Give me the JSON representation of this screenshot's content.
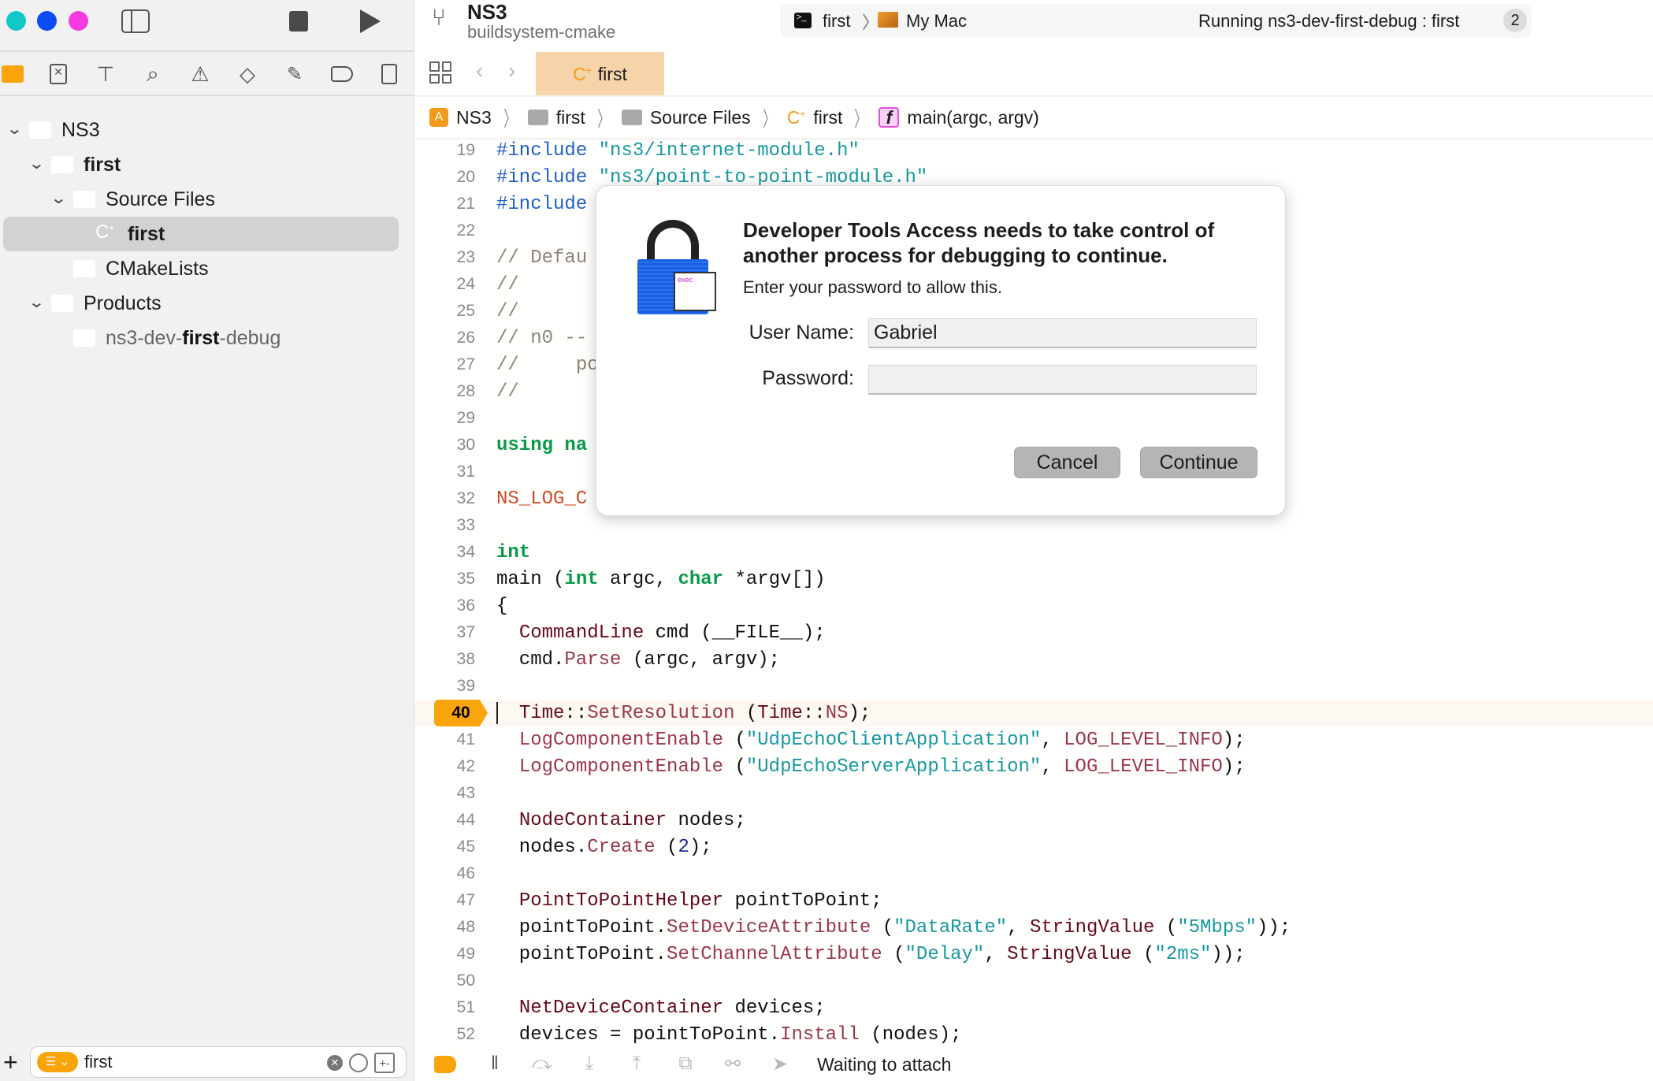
{
  "window": {
    "traffic_lights": [
      "#12c7c9",
      "#0a4cf5",
      "#f53ae2"
    ]
  },
  "toolbar": {
    "project": "NS3",
    "branch": "buildsystem-cmake",
    "scheme": "first",
    "destination": "My Mac",
    "status": "Running ns3-dev-first-debug : first",
    "badge": "2"
  },
  "navigator": {
    "icons": [
      "folder-icon",
      "source-control-icon",
      "hierarchy-icon",
      "search-icon",
      "warning-icon",
      "test-icon",
      "debug-icon",
      "breakpoint-icon",
      "report-icon"
    ],
    "tree": [
      {
        "label": "NS3",
        "icon": "app-icon",
        "level": 0,
        "chevron": true
      },
      {
        "label": "first",
        "icon": "folder-icon",
        "level": 1,
        "chevron": true,
        "bold": true
      },
      {
        "label": "Source Files",
        "icon": "folder-icon",
        "level": 2,
        "chevron": true
      },
      {
        "label": "first",
        "icon": "cpp-file-icon",
        "level": 3,
        "selected": true,
        "bold": true
      },
      {
        "label": "CMakeLists",
        "icon": "text-file-icon",
        "level": 2
      },
      {
        "label": "Products",
        "icon": "folder-icon",
        "level": 1,
        "chevron": true
      },
      {
        "label_pre": "ns3-dev-",
        "label_bold": "first",
        "label_post": "-debug",
        "icon": "executable-icon",
        "level": 2
      }
    ],
    "filter": {
      "value": "first"
    }
  },
  "editor": {
    "tab": {
      "label": "first"
    },
    "breadcrumb": [
      "NS3",
      "first",
      "Source Files",
      "first",
      "main(argc, argv)"
    ],
    "current_line": 40,
    "lines": [
      {
        "n": 19,
        "t": [
          [
            "pp",
            "#include "
          ],
          [
            "str",
            "\"ns3/internet-module.h\""
          ]
        ]
      },
      {
        "n": 20,
        "t": [
          [
            "pp",
            "#include "
          ],
          [
            "str",
            "\"ns3/point-to-point-module.h\""
          ]
        ]
      },
      {
        "n": 21,
        "t": [
          [
            "pp",
            "#include"
          ]
        ]
      },
      {
        "n": 22,
        "t": []
      },
      {
        "n": 23,
        "t": [
          [
            "cm",
            "// Defau"
          ]
        ]
      },
      {
        "n": 24,
        "t": [
          [
            "cm",
            "//"
          ]
        ]
      },
      {
        "n": 25,
        "t": [
          [
            "cm",
            "//"
          ]
        ]
      },
      {
        "n": 26,
        "t": [
          [
            "cm",
            "// n0 --"
          ]
        ]
      },
      {
        "n": 27,
        "t": [
          [
            "cm",
            "//     po"
          ]
        ]
      },
      {
        "n": 28,
        "t": [
          [
            "cm",
            "//"
          ]
        ]
      },
      {
        "n": 29,
        "t": []
      },
      {
        "n": 30,
        "t": [
          [
            "kw",
            "using"
          ],
          [
            "pl",
            " "
          ],
          [
            "kw",
            "na"
          ]
        ]
      },
      {
        "n": 31,
        "t": []
      },
      {
        "n": 32,
        "t": [
          [
            "mac",
            "NS_LOG_C"
          ]
        ]
      },
      {
        "n": 33,
        "t": []
      },
      {
        "n": 34,
        "t": [
          [
            "kw",
            "int"
          ]
        ]
      },
      {
        "n": 35,
        "t": [
          [
            "pl",
            "main ("
          ],
          [
            "kw",
            "int"
          ],
          [
            "pl",
            " argc, "
          ],
          [
            "kw",
            "char"
          ],
          [
            "pl",
            " *argv[])"
          ]
        ]
      },
      {
        "n": 36,
        "t": [
          [
            "pl",
            "{"
          ]
        ]
      },
      {
        "n": 37,
        "t": [
          [
            "pl",
            "  "
          ],
          [
            "ty",
            "CommandLine"
          ],
          [
            "pl",
            " cmd (__FILE__);"
          ]
        ]
      },
      {
        "n": 38,
        "t": [
          [
            "pl",
            "  cmd."
          ],
          [
            "fn",
            "Parse"
          ],
          [
            "pl",
            " (argc, argv);"
          ]
        ]
      },
      {
        "n": 39,
        "t": []
      },
      {
        "n": 40,
        "t": [
          [
            "pl",
            "  "
          ],
          [
            "ty",
            "Time"
          ],
          [
            "pl",
            "::"
          ],
          [
            "fn",
            "SetResolution"
          ],
          [
            "pl",
            " ("
          ],
          [
            "ty",
            "Time"
          ],
          [
            "pl",
            "::"
          ],
          [
            "fn",
            "NS"
          ],
          [
            "pl",
            ");"
          ]
        ]
      },
      {
        "n": 41,
        "t": [
          [
            "pl",
            "  "
          ],
          [
            "fn",
            "LogComponentEnable"
          ],
          [
            "pl",
            " ("
          ],
          [
            "str",
            "\"UdpEchoClientApplication\""
          ],
          [
            "pl",
            ", "
          ],
          [
            "fn",
            "LOG_LEVEL_INFO"
          ],
          [
            "pl",
            ");"
          ]
        ]
      },
      {
        "n": 42,
        "t": [
          [
            "pl",
            "  "
          ],
          [
            "fn",
            "LogComponentEnable"
          ],
          [
            "pl",
            " ("
          ],
          [
            "str",
            "\"UdpEchoServerApplication\""
          ],
          [
            "pl",
            ", "
          ],
          [
            "fn",
            "LOG_LEVEL_INFO"
          ],
          [
            "pl",
            ");"
          ]
        ]
      },
      {
        "n": 43,
        "t": []
      },
      {
        "n": 44,
        "t": [
          [
            "pl",
            "  "
          ],
          [
            "ty",
            "NodeContainer"
          ],
          [
            "pl",
            " nodes;"
          ]
        ]
      },
      {
        "n": 45,
        "t": [
          [
            "pl",
            "  nodes."
          ],
          [
            "fn",
            "Create"
          ],
          [
            "pl",
            " ("
          ],
          [
            "num",
            "2"
          ],
          [
            "pl",
            ");"
          ]
        ]
      },
      {
        "n": 46,
        "t": []
      },
      {
        "n": 47,
        "t": [
          [
            "pl",
            "  "
          ],
          [
            "ty",
            "PointToPointHelper"
          ],
          [
            "pl",
            " pointToPoint;"
          ]
        ]
      },
      {
        "n": 48,
        "t": [
          [
            "pl",
            "  pointToPoint."
          ],
          [
            "fn",
            "SetDeviceAttribute"
          ],
          [
            "pl",
            " ("
          ],
          [
            "str",
            "\"DataRate\""
          ],
          [
            "pl",
            ", "
          ],
          [
            "ty",
            "StringValue"
          ],
          [
            "pl",
            " ("
          ],
          [
            "str",
            "\"5Mbps\""
          ],
          [
            "pl",
            "));"
          ]
        ]
      },
      {
        "n": 49,
        "t": [
          [
            "pl",
            "  pointToPoint."
          ],
          [
            "fn",
            "SetChannelAttribute"
          ],
          [
            "pl",
            " ("
          ],
          [
            "str",
            "\"Delay\""
          ],
          [
            "pl",
            ", "
          ],
          [
            "ty",
            "StringValue"
          ],
          [
            "pl",
            " ("
          ],
          [
            "str",
            "\"2ms\""
          ],
          [
            "pl",
            "));"
          ]
        ]
      },
      {
        "n": 50,
        "t": []
      },
      {
        "n": 51,
        "t": [
          [
            "pl",
            "  "
          ],
          [
            "ty",
            "NetDeviceContainer"
          ],
          [
            "pl",
            " devices;"
          ]
        ]
      },
      {
        "n": 52,
        "t": [
          [
            "pl",
            "  devices = pointToPoint."
          ],
          [
            "fn",
            "Install"
          ],
          [
            "pl",
            " (nodes);"
          ]
        ]
      }
    ]
  },
  "dialog": {
    "title": "Developer Tools Access needs to take control of another process for debugging to continue.",
    "message": "Enter your password to allow this.",
    "icon_label": "exec",
    "username_label": "User Name:",
    "username_value": "Gabriel",
    "password_label": "Password:",
    "password_value": "",
    "cancel": "Cancel",
    "continue": "Continue"
  },
  "debugbar": {
    "status": "Waiting to attach"
  }
}
